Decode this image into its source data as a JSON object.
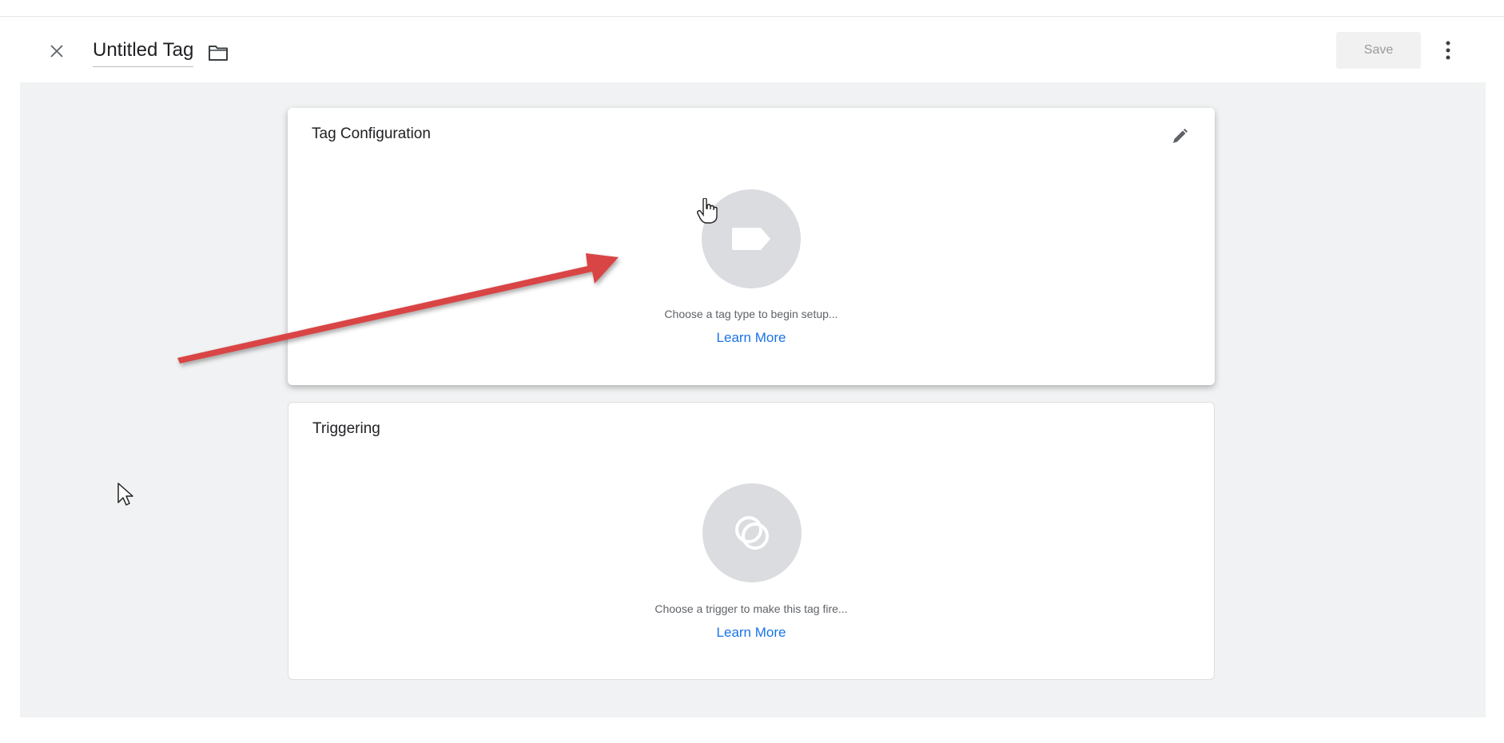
{
  "header": {
    "title": "Untitled Tag",
    "save_label": "Save",
    "close_icon": "close-icon",
    "folder_icon": "folder-icon",
    "more_icon": "more-vert-icon"
  },
  "cards": {
    "tag_configuration": {
      "title": "Tag Configuration",
      "icon": "tag-icon",
      "hint": "Choose a tag type to begin setup...",
      "link": "Learn More",
      "edit_icon": "pencil-icon"
    },
    "triggering": {
      "title": "Triggering",
      "icon": "trigger-icon",
      "hint": "Choose a trigger to make this tag fire...",
      "link": "Learn More"
    }
  },
  "annotation": {
    "arrow_color": "#d94444"
  },
  "colors": {
    "link": "#1a73e8",
    "canvas_bg": "#f1f2f3",
    "placeholder_circle": "#dadce0"
  }
}
